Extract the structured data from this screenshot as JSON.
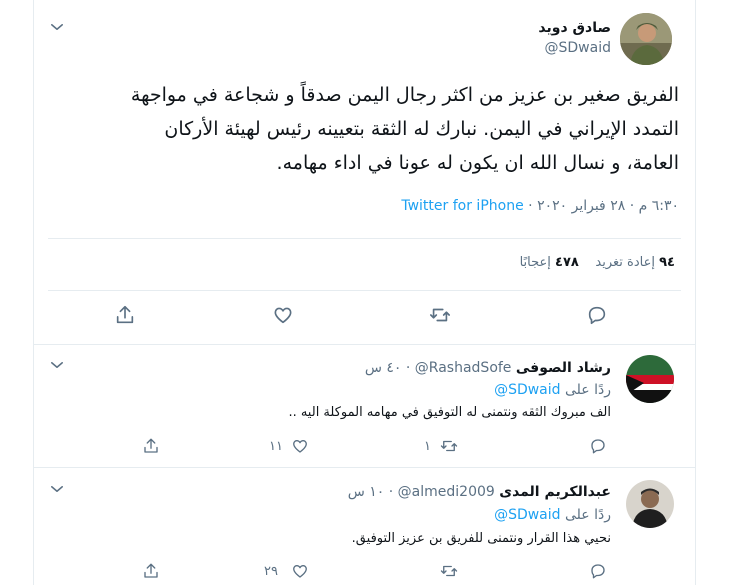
{
  "main_tweet": {
    "display_name": "صادق دويد",
    "handle": "@SDwaid",
    "text_line1": "الفريق صغير بن عزيز من اكثر رجال اليمن صدقاً و شجاعة في مواجهة",
    "text_line2": "التمدد الإيراني في اليمن. نبارك له الثقة بتعيينه رئيس لهيئة الأركان",
    "text_line3": "العامة، و نسال الله ان يكون له عونا في اداء مهامه.",
    "timestamp": "٦:٣٠ م · ٢٨ فبراير ٢٠٢٠ ·",
    "source": "Twitter for iPhone",
    "retweets_count": "٩٤",
    "retweets_label": "إعادة تغريد",
    "likes_count": "٤٧٨",
    "likes_label": "إعجابًا"
  },
  "replies": [
    {
      "display_name": "رشاد الصوفى",
      "handle": "@RashadSofe",
      "time": "· ٤٠ س",
      "replying_to_prefix": "ردًا على",
      "replying_to_handle": "@SDwaid",
      "text": "الف مبروك الثقه ونتمنى له التوفيق في مهامه الموكلة اليه ..",
      "retweets": "١",
      "likes": "١١"
    },
    {
      "display_name": "عبدالكريم المدى",
      "handle": "@almedi2009",
      "time": "· ١٠ س",
      "replying_to_prefix": "ردًا على",
      "replying_to_handle": "@SDwaid",
      "text": "نحيي هذا القرار ونتمنى للفريق بن عزيز التوفيق.",
      "retweets": "",
      "likes": "٢٩"
    }
  ],
  "icons": [
    "chevron-down-icon",
    "reply-icon",
    "retweet-icon",
    "like-icon",
    "share-icon"
  ],
  "colors": {
    "accent": "#1da1f2",
    "muted": "#5b7083",
    "border": "#e6ecf0",
    "flag_red": "#ce1126"
  }
}
